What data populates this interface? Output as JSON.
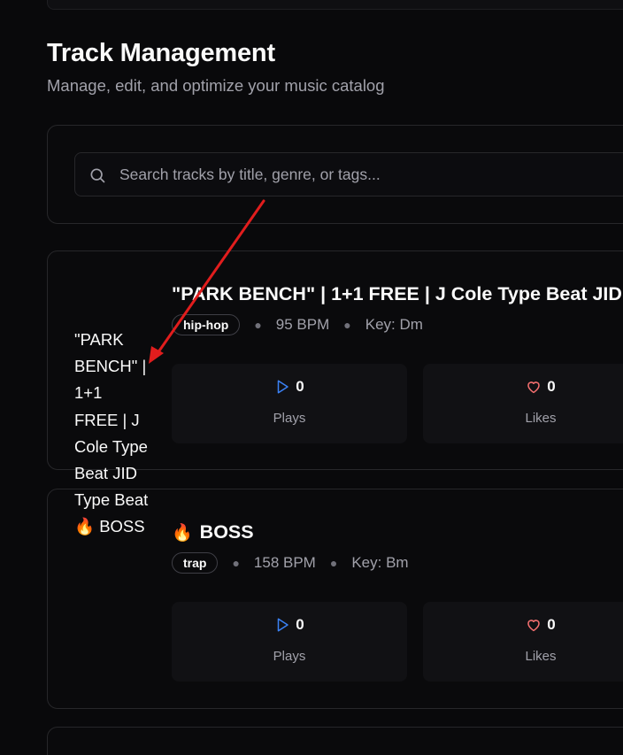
{
  "header": {
    "title": "Track Management",
    "subtitle": "Manage, edit, and optimize your music catalog"
  },
  "search": {
    "placeholder": "Search tracks by title, genre, or tags..."
  },
  "tracks": [
    {
      "title": "\"PARK BENCH\" | 1+1 FREE | J Cole Type Beat JID Type Beat",
      "genre": "hip-hop",
      "bpm": "95 BPM",
      "key": "Key: Dm",
      "plays": "0",
      "plays_label": "Plays",
      "likes": "0",
      "likes_label": "Likes"
    },
    {
      "emoji": "🔥",
      "title": "BOSS",
      "genre": "trap",
      "bpm": "158 BPM",
      "key": "Key: Bm",
      "plays": "0",
      "plays_label": "Plays",
      "likes": "0",
      "likes_label": "Likes"
    }
  ],
  "overflow_title": {
    "text": "\"PARK BENCH\" | 1+1 FREE | J Cole Type Beat JID Type Beat",
    "emoji": "🔥",
    "text2": "BOSS"
  },
  "colors": {
    "background": "#09090b",
    "card_border": "#27272a",
    "accent": "#1d63ed",
    "play_icon": "#3b82f6",
    "heart_icon": "#f87171",
    "annotation_arrow": "#e11d1d"
  },
  "icons": {
    "search": "search-icon",
    "play": "play-icon",
    "heart": "heart-icon"
  }
}
